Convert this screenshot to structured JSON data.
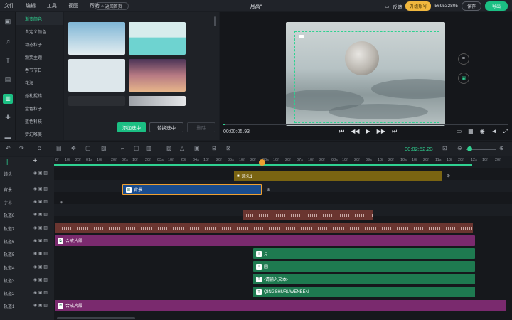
{
  "menu": [
    "文件",
    "编辑",
    "工具",
    "视图",
    "帮助"
  ],
  "home_button": "返回首页",
  "window_title": "月高*",
  "feedback": "反馈",
  "upgrade": "升级账号",
  "account": "569532805",
  "save": "保存",
  "export": "导出",
  "categories": [
    "渐变颜色",
    "自定义颜色",
    "动态粒子",
    "颁奖主题",
    "春节节日",
    "花海",
    "婚礼捉错",
    "金色粒子",
    "蓝色科技",
    "梦幻唯美"
  ],
  "buttons": {
    "add_selected": "添加选中",
    "replace_selected": "替换选中",
    "delete": "删除"
  },
  "preview": {
    "current_time": "00:00:05.93"
  },
  "timeline": {
    "timecode": "00:02:52.23",
    "ruler_labels": [
      "0f",
      "10f",
      "20f",
      "01s",
      "10f",
      "20f",
      "02s",
      "10f",
      "20f",
      "03s",
      "10f",
      "20f",
      "04s",
      "10f",
      "20f",
      "05s",
      "10f",
      "20f",
      "06s",
      "10f",
      "20f",
      "07s",
      "10f",
      "20f",
      "08s",
      "10f",
      "20f",
      "09s",
      "10f",
      "20f",
      "10s",
      "10f",
      "20f",
      "11s",
      "10f",
      "20f",
      "12s",
      "10f",
      "20f"
    ],
    "tracks": [
      "镜头",
      "背景",
      "字幕",
      "轨道8",
      "轨道7",
      "轨道6",
      "轨道5",
      "轨道4",
      "轨道3",
      "轨道2",
      "轨道1"
    ],
    "clips": {
      "camera": "镜头1",
      "background": "背景",
      "composite6": "合成片段",
      "t5": "月",
      "t4": "圆",
      "t3": "-请输入文本-",
      "t2": "QINGSHURUWENBEN",
      "composite1": "合成片段"
    }
  },
  "colors": {
    "accent": "#1bbf83",
    "upgrade": "#f0b73e",
    "playhead": "#f0a030"
  }
}
